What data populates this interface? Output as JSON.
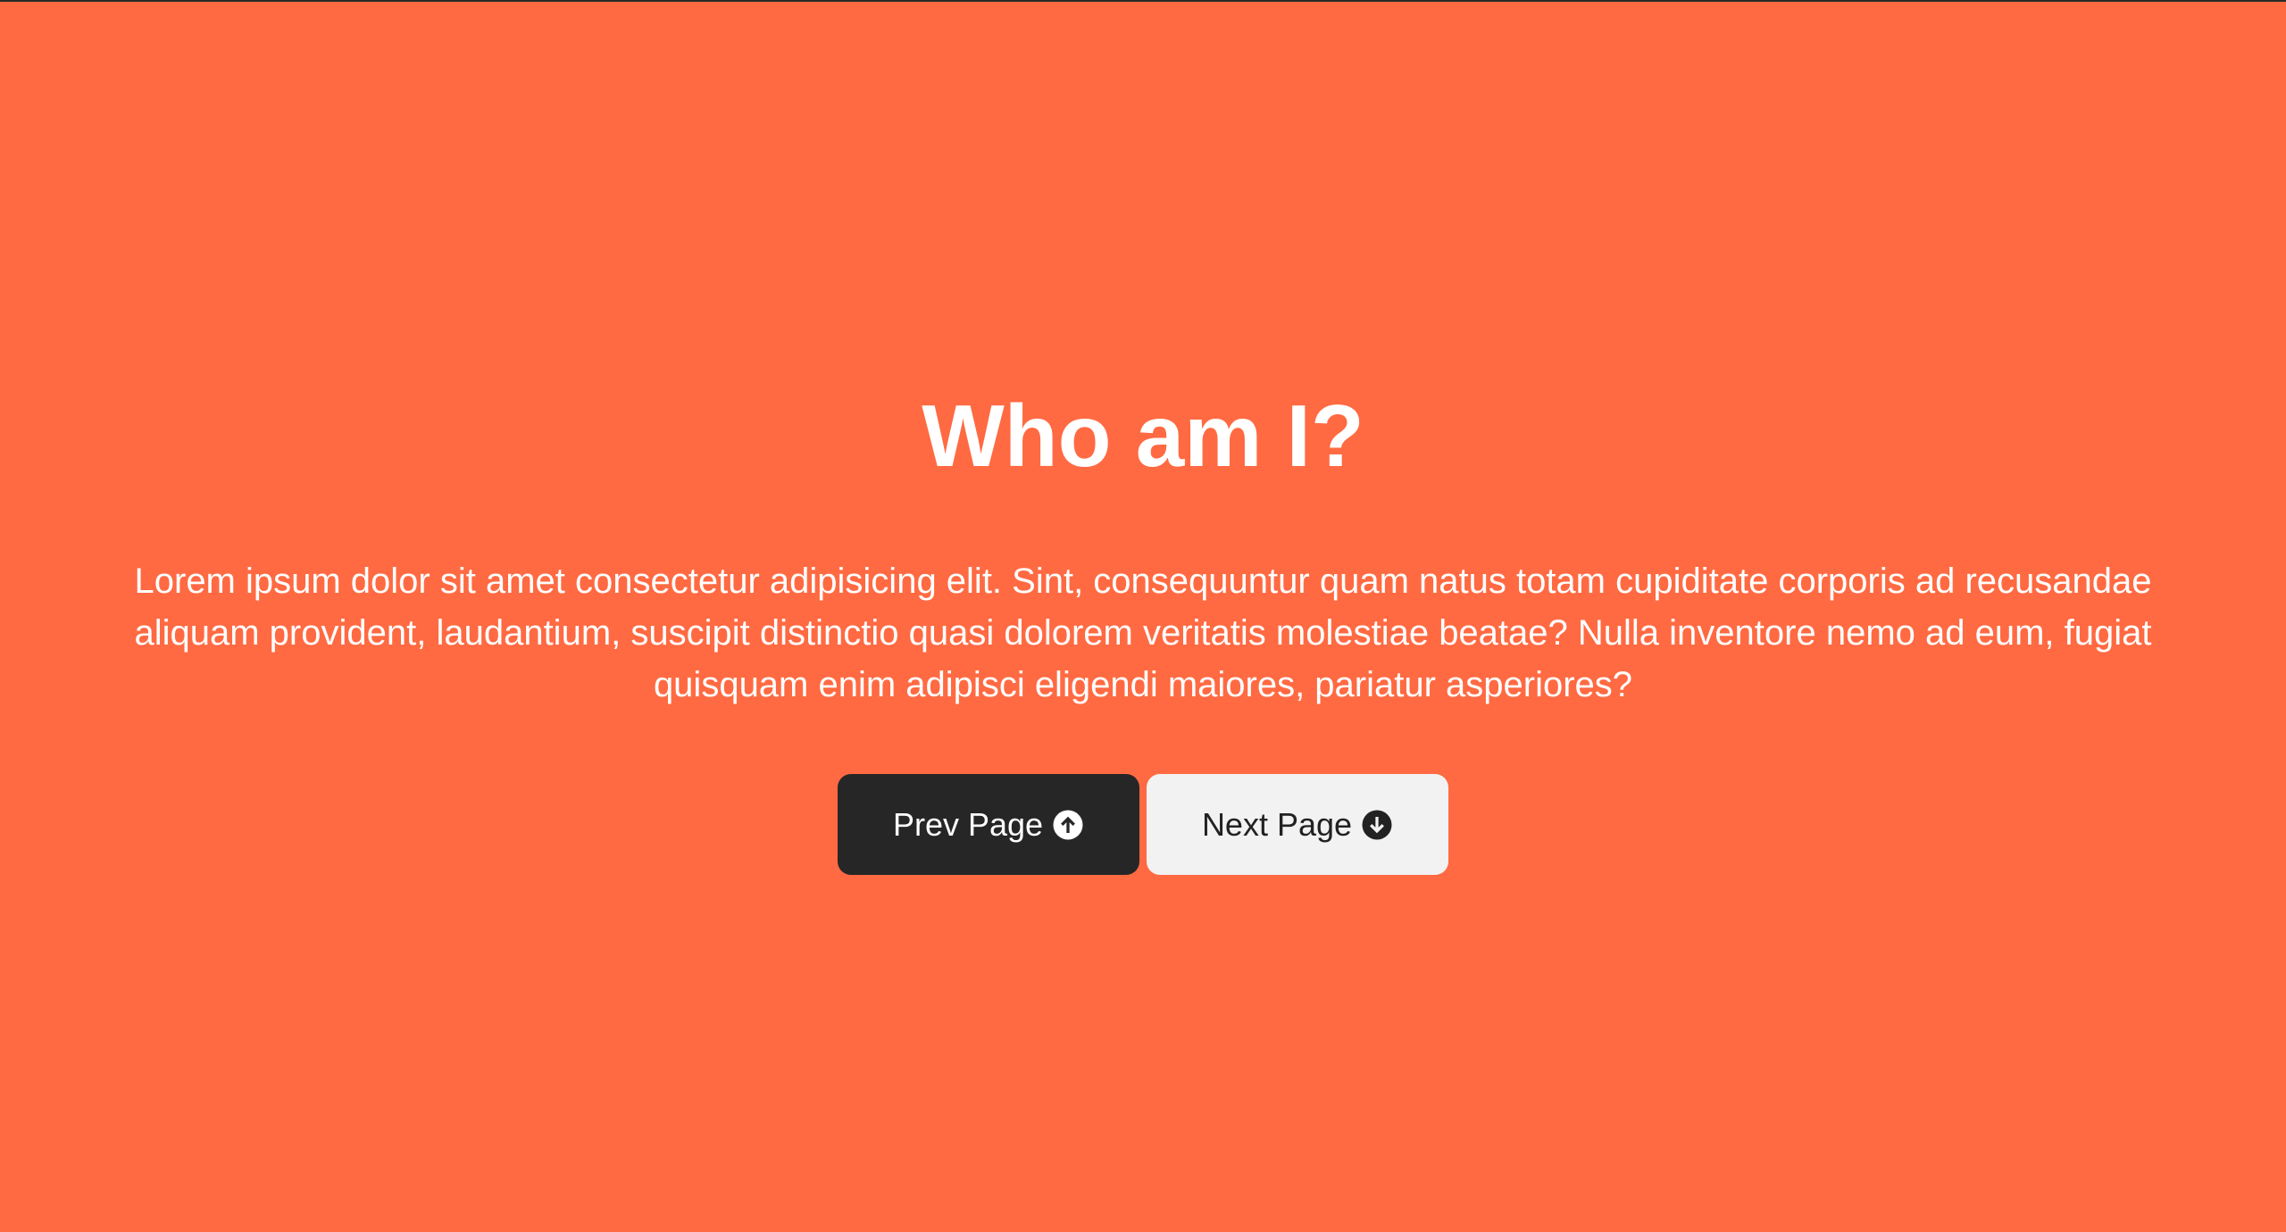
{
  "main": {
    "title": "Who am I?",
    "description": "Lorem ipsum dolor sit amet consectetur adipisicing elit. Sint, consequuntur quam natus totam cupiditate corporis ad recusandae aliquam provident, laudantium, suscipit distinctio quasi dolorem veritatis molestiae beatae? Nulla inventore nemo ad eum, fugiat quisquam enim adipisci eligendi maiores, pariatur asperiores?"
  },
  "buttons": {
    "prev_label": "Prev Page",
    "prev_icon": "arrow-circle-up-icon",
    "next_label": "Next Page",
    "next_icon": "arrow-circle-down-icon"
  },
  "colors": {
    "background": "#FF6A42",
    "prev_button": "#262626",
    "next_button": "#F2F2F2",
    "text": "#FFFFFF"
  }
}
